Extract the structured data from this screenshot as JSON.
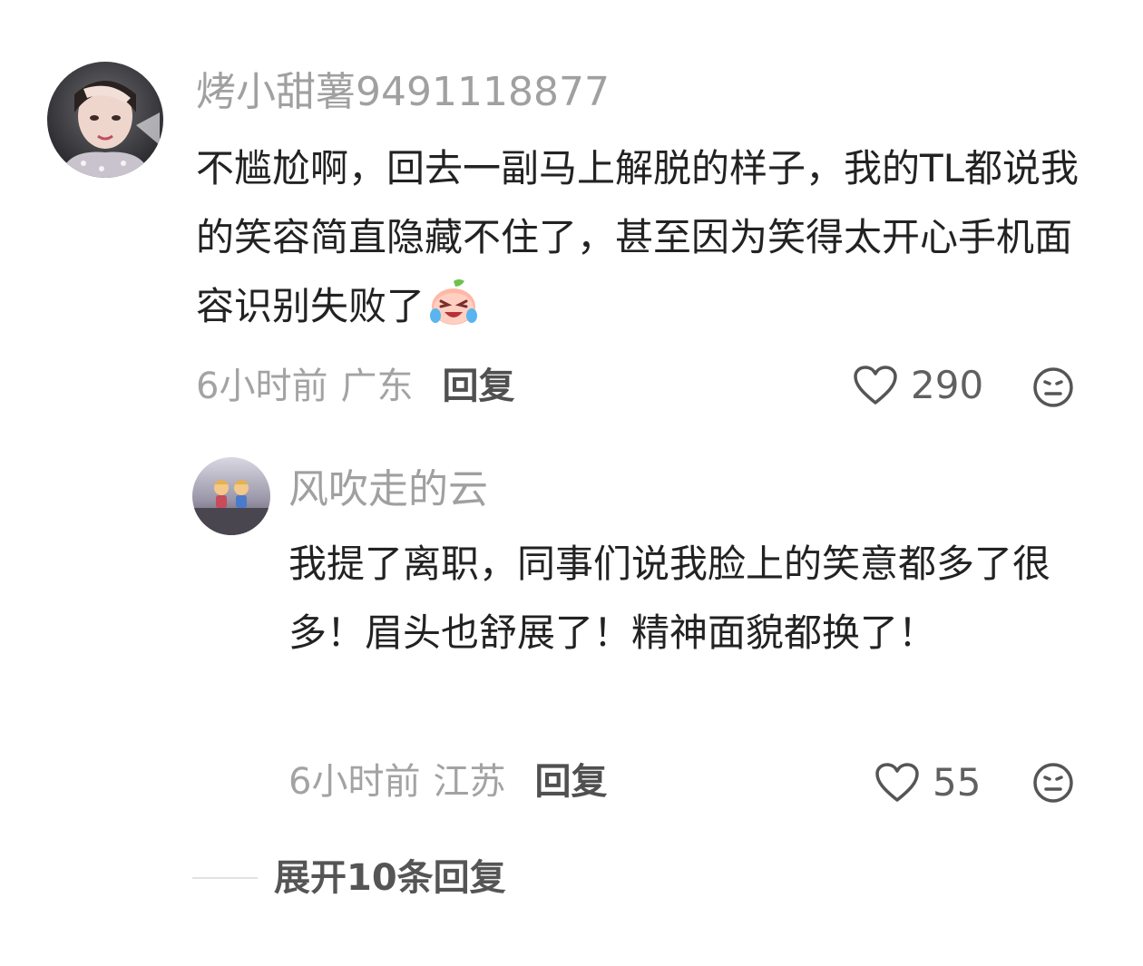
{
  "comments": [
    {
      "username": "烤小甜薯9491118877",
      "text_prefix": "不尴尬啊，回去一副马上解脱的样子，我的TL都说我的笑容简直隐藏不住了，甚至因为笑得太开心手机面容识别失败了",
      "inline_emoji": "laughing-crying-peach-emoji",
      "time": "6小时前",
      "location": "广东",
      "reply_label": "回复",
      "like_count": "290"
    }
  ],
  "replies": [
    {
      "username": "风吹走的云",
      "text": "我提了离职，同事们说我脸上的笑意都多了很多！眉头也舒展了！精神面貌都换了！",
      "time": "6小时前",
      "location": "江苏",
      "reply_label": "回复",
      "like_count": "55"
    }
  ],
  "expand_replies_label": "展开10条回复",
  "icons": {
    "like": "heart-outline-icon",
    "dislike": "neutral-face-icon"
  },
  "colors": {
    "username": "#a0a0a0",
    "text": "#222222",
    "meta": "#a3a3a3",
    "action": "#505050"
  }
}
